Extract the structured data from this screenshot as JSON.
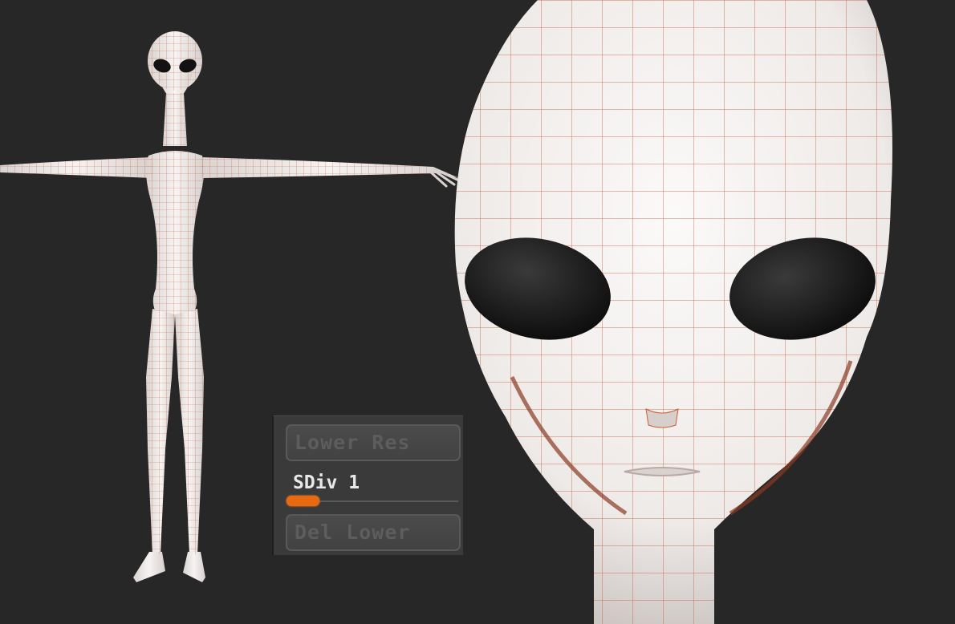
{
  "subdivision_panel": {
    "lower_res_label": "Lower Res",
    "sdiv_label": "SDiv 1",
    "sdiv_level_fraction": 0.19,
    "del_lower_label": "Del Lower"
  },
  "colors": {
    "background": "#272727",
    "panel": "#3a3a3a",
    "accent": "#e86a10",
    "mesh_wire": "#c8603c",
    "skin": "#f1eeed",
    "eye": "#121212"
  }
}
